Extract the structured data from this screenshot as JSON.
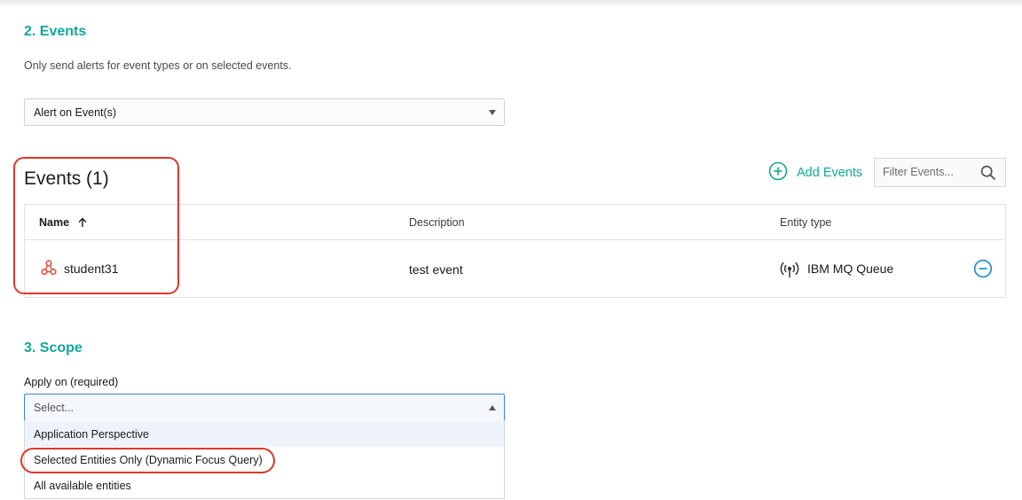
{
  "events_section": {
    "title": "2. Events",
    "description": "Only send alerts for event types or on selected events.",
    "alert_select_value": "Alert on Event(s)"
  },
  "events_table": {
    "heading": "Events (1)",
    "add_label": "Add Events",
    "filter_placeholder": "Filter Events...",
    "columns": {
      "name": "Name",
      "description": "Description",
      "entity_type": "Entity type"
    },
    "rows": [
      {
        "name": "student31",
        "description": "test event",
        "entity_type": "IBM MQ Queue"
      }
    ]
  },
  "scope_section": {
    "title": "3. Scope",
    "apply_label": "Apply on (required)",
    "select_placeholder": "Select...",
    "options": [
      "Application Perspective",
      "Selected Entities Only (Dynamic Focus Query)",
      "All available entities"
    ]
  },
  "colors": {
    "accent": "#11a89a",
    "highlight": "#e2352a",
    "remove": "#1a8fd6",
    "event_icon": "#e8483f"
  },
  "icons": {
    "add": "plus-circle-icon",
    "search": "magnifier-icon",
    "sort": "arrow-up-icon",
    "event": "event-cluster-icon",
    "entity": "mq-queue-icon",
    "remove": "minus-circle-icon"
  }
}
